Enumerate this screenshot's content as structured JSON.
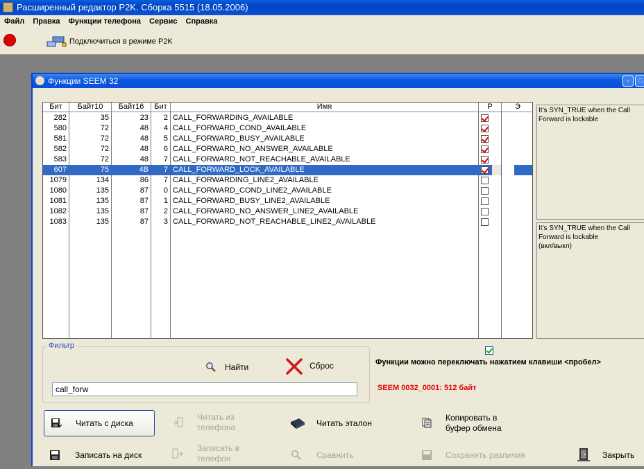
{
  "app": {
    "title": "Расширенный редактор P2K. Сборка 5515 (18.05.2006)"
  },
  "menu": [
    "Файл",
    "Правка",
    "Функции телефона",
    "Сервис",
    "Справка"
  ],
  "toolbar": {
    "connect_label": "Подключиться в режиме P2K"
  },
  "dialog": {
    "title": "Функции SEEM 32"
  },
  "table": {
    "headers": [
      "Бит",
      "Байт10",
      "Байт16",
      "Бит",
      "Имя",
      "Р",
      "Э"
    ],
    "rows": [
      {
        "bit": "282",
        "b10": "35",
        "b16": "23",
        "sub": "2",
        "name": "CALL_FORWARDING_AVAILABLE",
        "p": true,
        "sel": false
      },
      {
        "bit": "580",
        "b10": "72",
        "b16": "48",
        "sub": "4",
        "name": "CALL_FORWARD_COND_AVAILABLE",
        "p": true,
        "sel": false
      },
      {
        "bit": "581",
        "b10": "72",
        "b16": "48",
        "sub": "5",
        "name": "CALL_FORWARD_BUSY_AVAILABLE",
        "p": true,
        "sel": false
      },
      {
        "bit": "582",
        "b10": "72",
        "b16": "48",
        "sub": "6",
        "name": "CALL_FORWARD_NO_ANSWER_AVAILABLE",
        "p": true,
        "sel": false
      },
      {
        "bit": "583",
        "b10": "72",
        "b16": "48",
        "sub": "7",
        "name": "CALL_FORWARD_NOT_REACHABLE_AVAILABLE",
        "p": true,
        "sel": false
      },
      {
        "bit": "607",
        "b10": "75",
        "b16": "4B",
        "sub": "7",
        "name": "CALL_FORWARD_LOCK_AVAILABLE",
        "p": true,
        "sel": true
      },
      {
        "bit": "1079",
        "b10": "134",
        "b16": "86",
        "sub": "7",
        "name": "CALL_FORWARDING_LINE2_AVAILABLE",
        "p": false,
        "sel": false
      },
      {
        "bit": "1080",
        "b10": "135",
        "b16": "87",
        "sub": "0",
        "name": "CALL_FORWARD_COND_LINE2_AVAILABLE",
        "p": false,
        "sel": false
      },
      {
        "bit": "1081",
        "b10": "135",
        "b16": "87",
        "sub": "1",
        "name": "CALL_FORWARD_BUSY_LINE2_AVAILABLE",
        "p": false,
        "sel": false
      },
      {
        "bit": "1082",
        "b10": "135",
        "b16": "87",
        "sub": "2",
        "name": "CALL_FORWARD_NO_ANSWER_LINE2_AVAILABLE",
        "p": false,
        "sel": false
      },
      {
        "bit": "1083",
        "b10": "135",
        "b16": "87",
        "sub": "3",
        "name": "CALL_FORWARD_NOT_REACHABLE_LINE2_AVAILABLE",
        "p": false,
        "sel": false
      }
    ]
  },
  "memo1": "It's SYN_TRUE when the Call Forward is lockable",
  "memo2_line1": "It's SYN_TRUE when the Call Forward is lockable",
  "memo2_line2": "(вкл/выкл)",
  "filter": {
    "label": "Фильтр",
    "find": "Найти",
    "reset": "Сброс",
    "value": "call_forw"
  },
  "space_toggle_label": "Функции можно переключать нажатием клавиши <пробел>",
  "seem_info": "SEEM 0032_0001: 512 байт",
  "buttons": {
    "read_disk": "Читать с диска",
    "read_phone_1": "Читать из",
    "read_phone_2": "телефона",
    "read_ref": "Читать эталон",
    "copy_1": "Копировать в",
    "copy_2": "буфер обмена",
    "write_disk": "Записать на диск",
    "write_phone_1": "Записать в",
    "write_phone_2": "телефон",
    "compare": "Сравнить",
    "save_diff": "Сохранить различия",
    "close": "Закрыть"
  }
}
